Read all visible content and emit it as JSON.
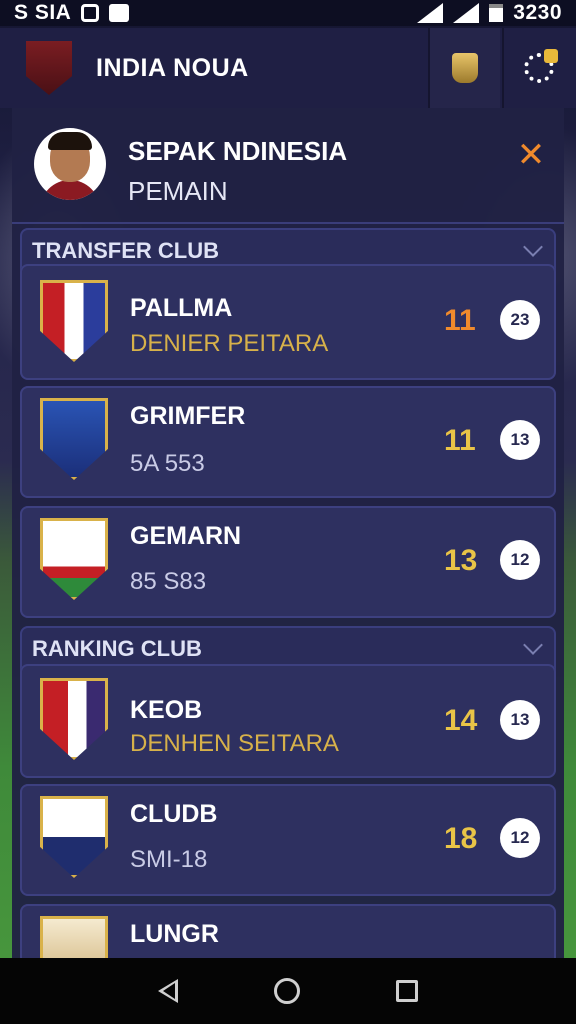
{
  "status_bar": {
    "left_text": "S SIA",
    "time": "3230"
  },
  "header": {
    "title": "INDIA NOUA"
  },
  "profile": {
    "name": "SEPAK NDINESIA",
    "role": "PEMAIN"
  },
  "sections": [
    {
      "title": "TRANSFER CLUB",
      "items": [
        {
          "name": "PALLMA",
          "sub": "DENIER PEITARA",
          "value": "11",
          "badge": "23"
        },
        {
          "name": "GRIMFER",
          "sub": "5A 553",
          "value": "11",
          "badge": "13"
        },
        {
          "name": "GEMARN",
          "sub": "85 S83",
          "value": "13",
          "badge": "12"
        }
      ]
    },
    {
      "title": "RANKING CLUB",
      "items": [
        {
          "name": "KEOB",
          "sub": "DENHEN SEITARA",
          "value": "14",
          "badge": "13"
        },
        {
          "name": "CLUDB",
          "sub": "SMI-18",
          "value": "18",
          "badge": "12"
        },
        {
          "name": "LUNGR"
        }
      ]
    }
  ],
  "colors": {
    "accent_orange": "#f08a2c",
    "accent_gold": "#e9c447",
    "panel": "#202144"
  },
  "icons": [
    "wifi-icon",
    "signal-icon",
    "battery-icon",
    "trophy-icon",
    "spinner-icon",
    "close-icon",
    "chevron-down-icon",
    "back-icon",
    "home-icon",
    "recents-icon"
  ]
}
